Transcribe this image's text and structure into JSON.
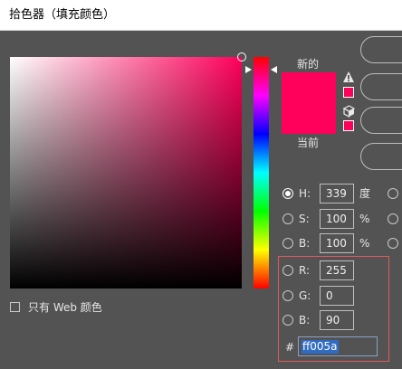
{
  "window": {
    "title": "拾色器（填充颜色）"
  },
  "colors": {
    "selected": "#ff005a",
    "accent_highlight": "#2f6cc2",
    "annotation_box": "#e05a5a"
  },
  "swatches": {
    "new_label": "新的",
    "current_label": "当前"
  },
  "icons": {
    "gamut_warning": "warning-triangle-icon",
    "web_safe": "cube-icon"
  },
  "hsb": {
    "h": {
      "label": "H:",
      "value": "339",
      "unit": "度",
      "selected": true
    },
    "s": {
      "label": "S:",
      "value": "100",
      "unit": "%",
      "selected": false
    },
    "b": {
      "label": "B:",
      "value": "100",
      "unit": "%",
      "selected": false
    }
  },
  "rgb": {
    "r": {
      "label": "R:",
      "value": "255",
      "selected": false
    },
    "g": {
      "label": "G:",
      "value": "0",
      "selected": false
    },
    "b": {
      "label": "B:",
      "value": "90",
      "selected": false
    }
  },
  "hex": {
    "label": "#",
    "value": "ff005a"
  },
  "web_only": {
    "label": "只有 Web 颜色",
    "checked": false
  }
}
